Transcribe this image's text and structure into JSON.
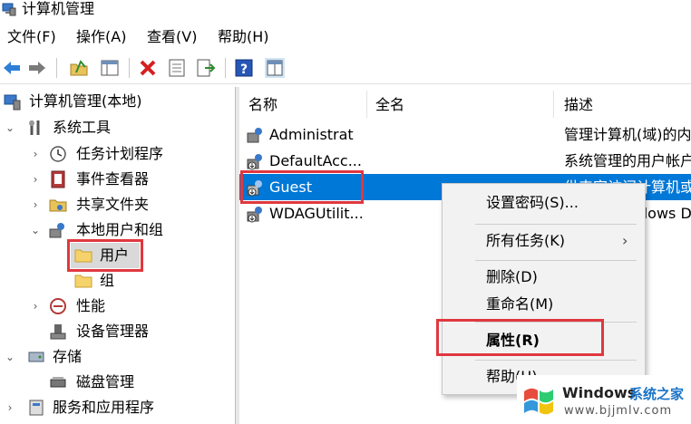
{
  "window": {
    "title": "计算机管理"
  },
  "menu": [
    "文件(F)",
    "操作(A)",
    "查看(V)",
    "帮助(H)"
  ],
  "tree": {
    "root": "计算机管理(本地)",
    "system_tools": "系统工具",
    "task_scheduler": "任务计划程序",
    "event_viewer": "事件查看器",
    "shared_folders": "共享文件夹",
    "local_users_groups": "本地用户和组",
    "users": "用户",
    "groups": "组",
    "performance": "性能",
    "device_manager": "设备管理器",
    "storage": "存储",
    "disk_management": "磁盘管理",
    "services_apps": "服务和应用程序"
  },
  "list": {
    "columns": [
      "名称",
      "全名",
      "描述"
    ],
    "rows": [
      {
        "name": "Administrat",
        "fullname": "",
        "desc": "管理计算机(域)的内"
      },
      {
        "name": "DefaultAcc...",
        "fullname": "",
        "desc": "系统管理的用户帐户"
      },
      {
        "name": "Guest",
        "fullname": "",
        "desc": "供来宾访问计算机或"
      },
      {
        "name": "WDAGUtilit...",
        "fullname": "",
        "desc": "dows D"
      }
    ]
  },
  "context_menu": {
    "set_password": "设置密码(S)...",
    "all_tasks": "所有任务(K)",
    "delete": "删除(D)",
    "rename": "重命名(M)",
    "properties": "属性(R)",
    "help": "帮助(H)"
  },
  "watermark": {
    "brand": "Windows",
    "site_cn": "系统之家",
    "url": "www.bjjmlv.com"
  },
  "colors": {
    "selection": "#0078d7",
    "highlight_box": "#e0383f",
    "folder": "#f6d26a"
  }
}
